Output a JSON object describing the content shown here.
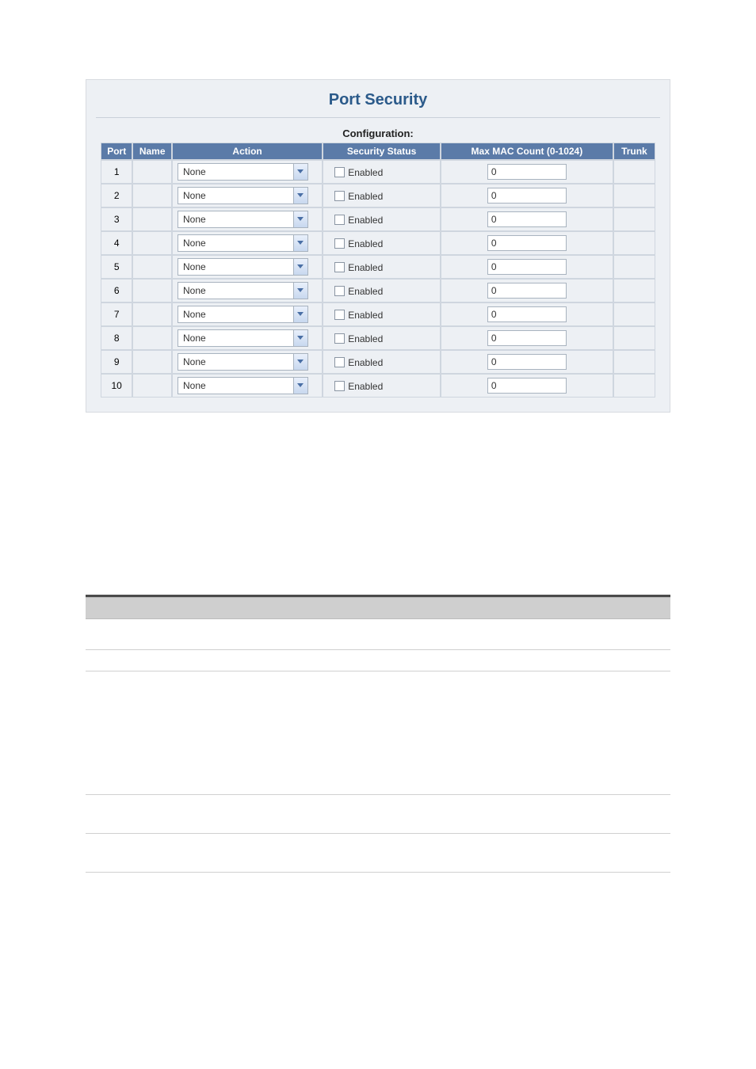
{
  "title": "Port Security",
  "subtitle": "Configuration:",
  "headers": {
    "port": "Port",
    "name": "Name",
    "action": "Action",
    "status": "Security Status",
    "maxmac": "Max MAC Count (0-1024)",
    "trunk": "Trunk"
  },
  "statusLabel": "Enabled",
  "rows": [
    {
      "port": "1",
      "name": "",
      "action": "None",
      "enabled": false,
      "max": "0",
      "trunk": ""
    },
    {
      "port": "2",
      "name": "",
      "action": "None",
      "enabled": false,
      "max": "0",
      "trunk": ""
    },
    {
      "port": "3",
      "name": "",
      "action": "None",
      "enabled": false,
      "max": "0",
      "trunk": ""
    },
    {
      "port": "4",
      "name": "",
      "action": "None",
      "enabled": false,
      "max": "0",
      "trunk": ""
    },
    {
      "port": "5",
      "name": "",
      "action": "None",
      "enabled": false,
      "max": "0",
      "trunk": ""
    },
    {
      "port": "6",
      "name": "",
      "action": "None",
      "enabled": false,
      "max": "0",
      "trunk": ""
    },
    {
      "port": "7",
      "name": "",
      "action": "None",
      "enabled": false,
      "max": "0",
      "trunk": ""
    },
    {
      "port": "8",
      "name": "",
      "action": "None",
      "enabled": false,
      "max": "0",
      "trunk": ""
    },
    {
      "port": "9",
      "name": "",
      "action": "None",
      "enabled": false,
      "max": "0",
      "trunk": ""
    },
    {
      "port": "10",
      "name": "",
      "action": "None",
      "enabled": false,
      "max": "0",
      "trunk": ""
    }
  ]
}
